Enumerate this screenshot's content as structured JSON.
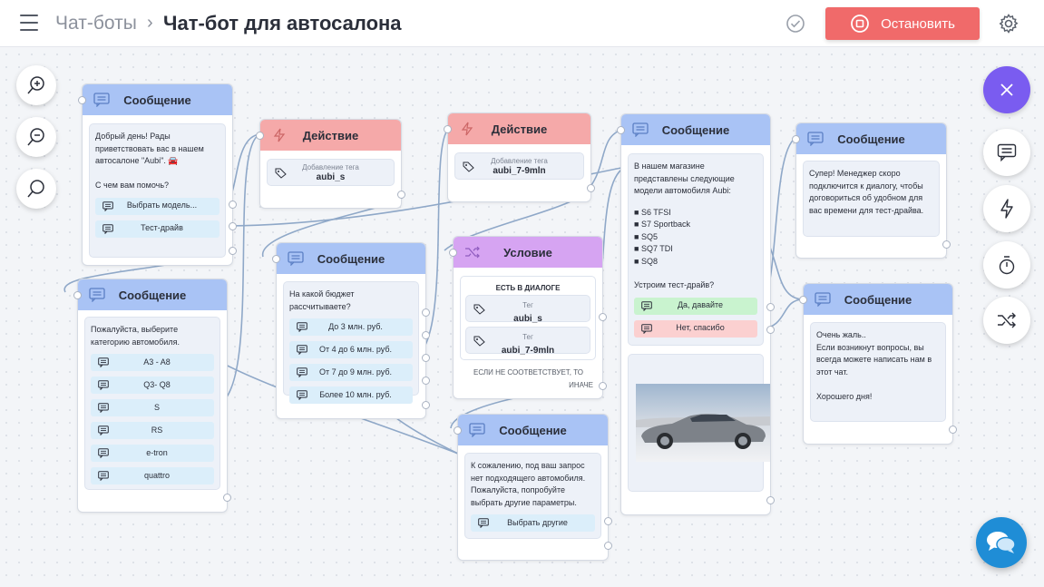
{
  "header": {
    "breadcrumb_root": "Чат-боты",
    "breadcrumb_sep": "›",
    "title": "Чат-бот для автосалона",
    "stop_label": "Остановить"
  },
  "colors": {
    "stop": "#f06a6a",
    "message_header": "#a9c3f5",
    "action_header": "#f5a9a9",
    "condition_header": "#d6a4f2",
    "close_fab": "#7a5cf0",
    "chat_fab": "#1f8dd6"
  },
  "toolbar_right": {
    "icons": [
      "close-icon",
      "message-icon",
      "lightning-icon",
      "timer-icon",
      "shuffle-icon"
    ]
  },
  "nodes": {
    "msg_welcome": {
      "title": "Сообщение",
      "text": "Добрый день! Рады приветствовать вас в нашем автосалоне \"Aubi\". 🚘\n\nС чем вам помочь?",
      "buttons": [
        "Выбрать модель...",
        "Тест-драйв"
      ]
    },
    "act_1": {
      "title": "Действие",
      "sub": "Добавление тега",
      "value": "aubi_s"
    },
    "act_2": {
      "title": "Действие",
      "sub": "Добавление тега",
      "value": "aubi_7-9mln"
    },
    "msg_models": {
      "title": "Сообщение",
      "intro": "В нашем магазине представлены следующие модели автомобиля Aubi:",
      "list": [
        "S6 TFSI",
        "S7 Sportback",
        "SQ5",
        "SQ7 TDI",
        "SQ8"
      ],
      "question": "Устроим тест-драйв?",
      "buttons": [
        "Да, давайте",
        "Нет, спасибо"
      ]
    },
    "msg_manager": {
      "title": "Сообщение",
      "text": "Супер! Менеджер скоро подключится к диалогу, чтобы договориться об удобном для вас времени для тест-драйва."
    },
    "msg_category": {
      "title": "Сообщение",
      "text": "Пожалуйста, выберите категорию автомобиля.",
      "buttons": [
        "A3 - A8",
        "Q3- Q8",
        "S",
        "RS",
        "e-tron",
        "quattro"
      ]
    },
    "msg_budget": {
      "title": "Сообщение",
      "text": "На какой бюджет рассчитываете?",
      "buttons": [
        "До 3 млн. руб.",
        "От 4 до 6 млн. руб.",
        "От 7 до 9 млн. руб.",
        "Более 10 млн. руб."
      ]
    },
    "cond": {
      "title": "Условие",
      "has": "ЕСТЬ В ДИАЛОГЕ",
      "tag_sub": "Тег",
      "tags": [
        "aubi_s",
        "aubi_7-9mln"
      ],
      "else_line1": "ЕСЛИ НЕ СООТВЕТСТВУЕТ, ТО",
      "else_line2": "ИНАЧЕ"
    },
    "msg_sorry": {
      "title": "Сообщение",
      "text": "К сожалению, под ваш запрос нет подходящего автомобиля. Пожалуйста, попробуйте выбрать другие параметры.",
      "buttons": [
        "Выбрать другие"
      ]
    },
    "msg_bye": {
      "title": "Сообщение",
      "text": "Очень жаль..\nЕсли возникнут вопросы, вы всегда можете написать нам в этот чат.\n\nХорошего дня!"
    }
  }
}
